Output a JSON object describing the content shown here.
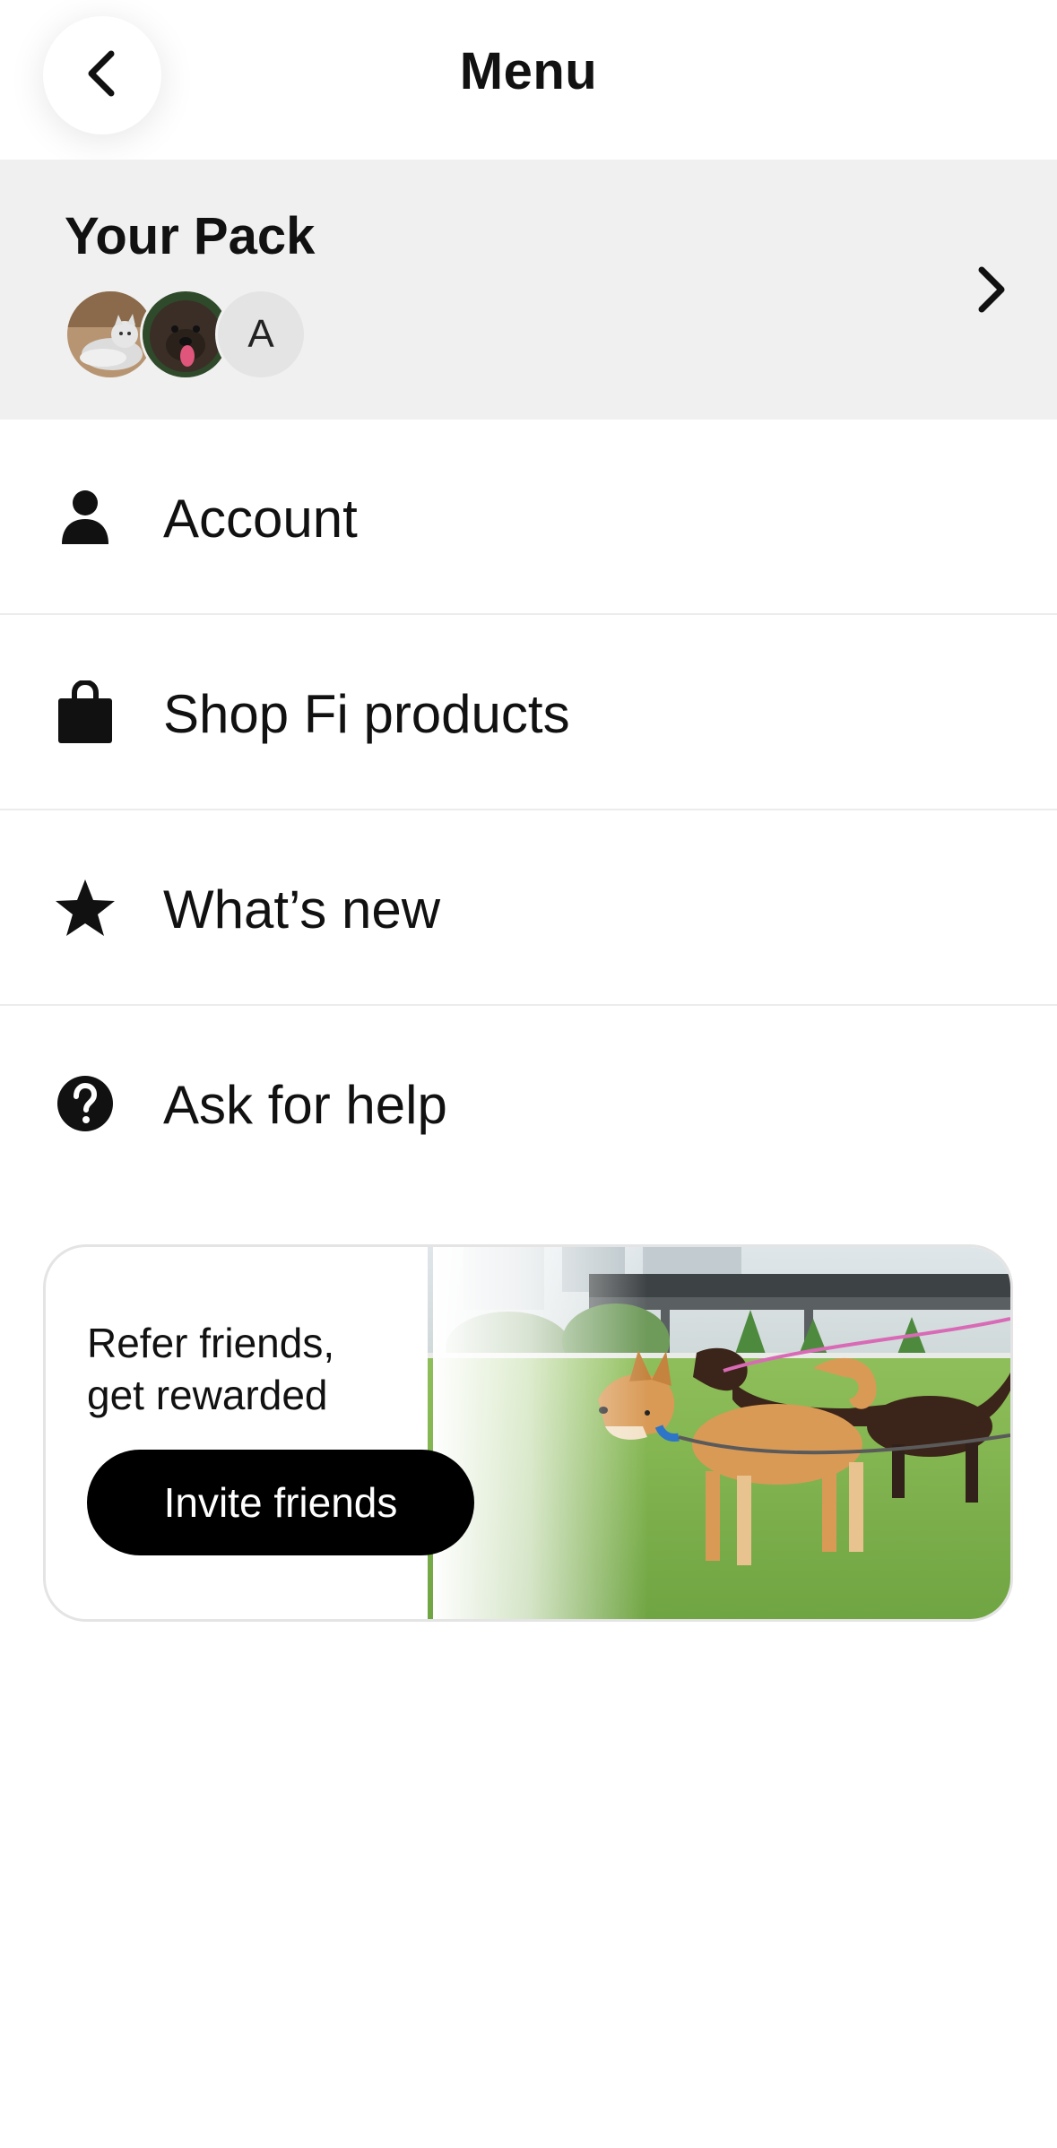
{
  "header": {
    "title": "Menu",
    "back_icon": "chevron-left-icon"
  },
  "pack": {
    "title": "Your Pack",
    "avatars": [
      {
        "type": "photo",
        "subject": "cat"
      },
      {
        "type": "photo",
        "subject": "dog"
      },
      {
        "type": "letter",
        "letter": "A"
      }
    ],
    "chevron_icon": "chevron-right-icon"
  },
  "menu": {
    "items": [
      {
        "label": "Account",
        "icon": "person-icon"
      },
      {
        "label": "Shop Fi products",
        "icon": "shopping-bag-icon"
      },
      {
        "label": "What’s new",
        "icon": "star-icon"
      },
      {
        "label": "Ask for help",
        "icon": "help-circle-icon"
      }
    ]
  },
  "refer": {
    "line1": "Refer friends,",
    "line2": "get rewarded",
    "button_label": "Invite friends"
  },
  "colors": {
    "pack_background": "#f0f0f0",
    "button_background": "#000000",
    "button_text": "#ffffff",
    "divider": "#ececec"
  }
}
